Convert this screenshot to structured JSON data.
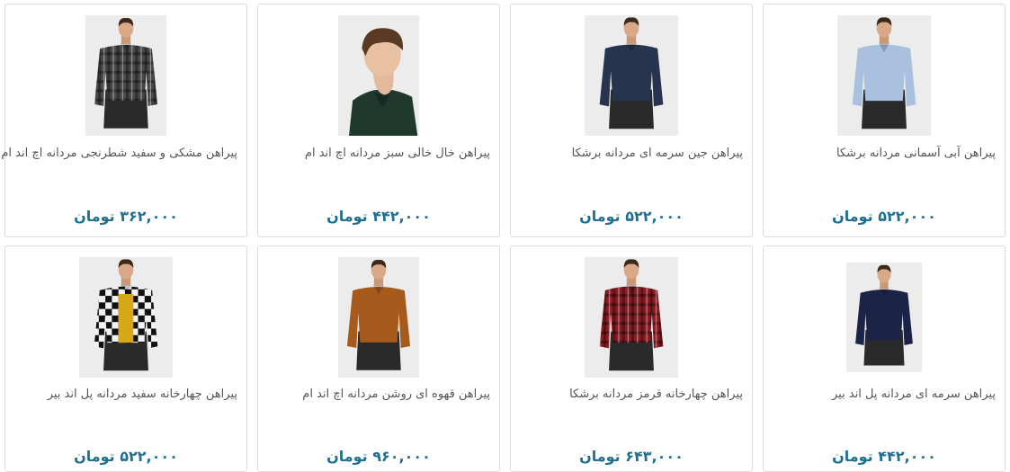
{
  "products": [
    {
      "title": "پیراهن آبی آسمانی مردانه برشکا",
      "price": "۵۲۲,۰۰۰ تومان",
      "image": "light-blue-shirt-photo",
      "shirt_color": "#a9c0de",
      "pattern": "plain"
    },
    {
      "title": "پیراهن جین سرمه ای مردانه برشکا",
      "price": "۵۲۲,۰۰۰ تومان",
      "image": "navy-denim-shirt-photo",
      "shirt_color": "#27344e",
      "pattern": "plain"
    },
    {
      "title": "پیراهن خال خالی سبز مردانه اچ اند ام",
      "price": "۴۴۲,۰۰۰ تومان",
      "image": "green-dotted-shirt-photo",
      "shirt_color": "#1f3a2d",
      "pattern": "profile"
    },
    {
      "title": "پیراهن مشکی و سفید شطرنجی مردانه اچ اند ام",
      "price": "۳۶۲,۰۰۰ تومان",
      "image": "black-white-check-shirt-photo",
      "shirt_color": "#4a4a4a",
      "pattern": "check"
    },
    {
      "title": "پیراهن سرمه ای مردانه پل اند بیر",
      "price": "۴۴۲,۰۰۰ تومان",
      "image": "navy-shirt-photo",
      "shirt_color": "#1b2447",
      "pattern": "plain"
    },
    {
      "title": "پیراهن چهارخانه قرمز مردانه برشکا",
      "price": "۶۴۳,۰۰۰ تومان",
      "image": "red-check-shirt-photo",
      "shirt_color": "#8a1d24",
      "pattern": "check"
    },
    {
      "title": "پیراهن قهوه ای روشن مردانه اچ اند ام",
      "price": "۹۶۰,۰۰۰ تومان",
      "image": "light-brown-shirt-photo",
      "shirt_color": "#a65a1c",
      "pattern": "plain"
    },
    {
      "title": "پیراهن چهارخانه سفید مردانه پل اند بیر",
      "price": "۵۲۲,۰۰۰ تومان",
      "image": "white-check-shirt-photo",
      "shirt_color": "#f0f0f0",
      "pattern": "bigcheck"
    }
  ],
  "colors": {
    "price": "#1f6f93",
    "title": "#555555",
    "border": "#dcdcdc"
  }
}
